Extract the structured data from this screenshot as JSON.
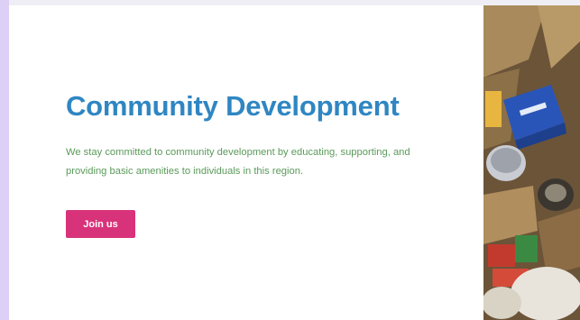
{
  "hero": {
    "title": "Community Development",
    "description": "We stay committed to community development by educating, supporting, and providing basic amenities to individuals in this region.",
    "cta_label": "Join us"
  },
  "image": {
    "subject": "food-donation-box-photo"
  },
  "colors": {
    "title": "#2f86c2",
    "description": "#5a9a5a",
    "cta_background": "#d8337a",
    "page_background": "#ffffff",
    "left_strip": "#dcd0f6"
  }
}
